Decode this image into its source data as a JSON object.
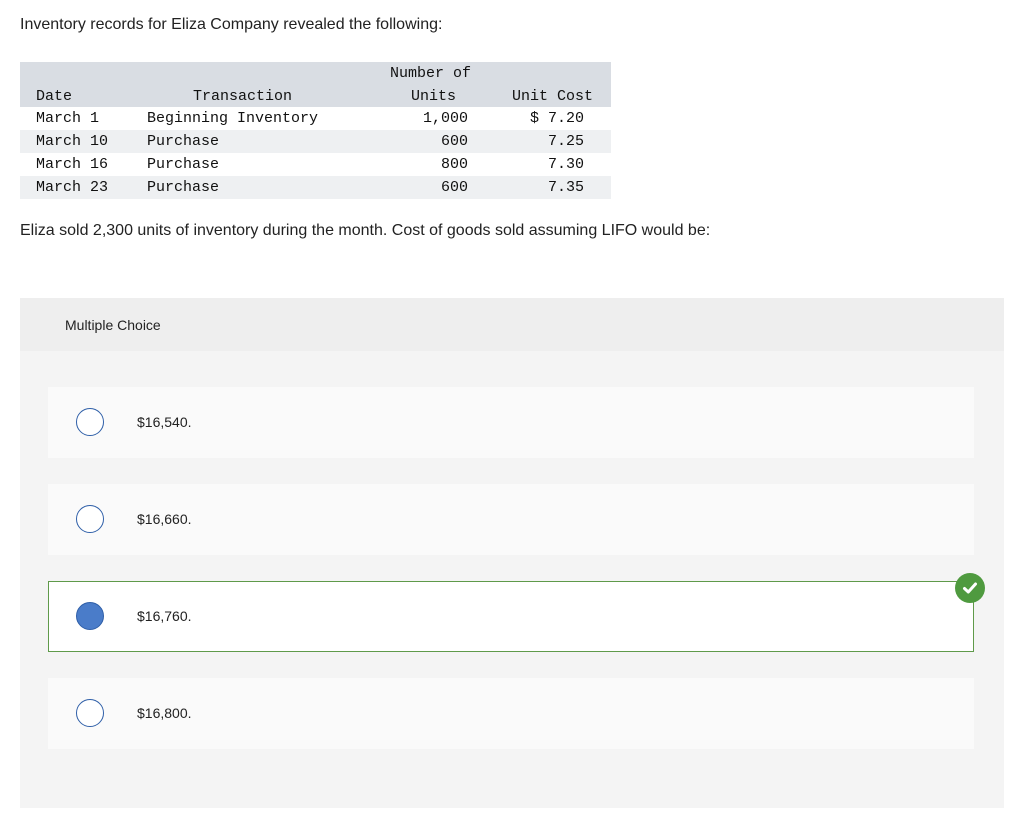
{
  "intro_text": "Inventory records for Eliza Company revealed the following:",
  "table": {
    "headers": {
      "date": "Date",
      "transaction": "Transaction",
      "units_line1": "Number of",
      "units_line2": "Units",
      "cost": "Unit Cost"
    },
    "rows": [
      {
        "date": "March 1",
        "transaction": "Beginning Inventory",
        "units": "1,000",
        "cost": "$ 7.20"
      },
      {
        "date": "March 10",
        "transaction": "Purchase",
        "units": "600",
        "cost": "7.25"
      },
      {
        "date": "March 16",
        "transaction": "Purchase",
        "units": "800",
        "cost": "7.30"
      },
      {
        "date": "March 23",
        "transaction": "Purchase",
        "units": "600",
        "cost": "7.35"
      }
    ]
  },
  "question_text": "Eliza sold 2,300 units of inventory during the month. Cost of goods sold assuming LIFO would be:",
  "multiple_choice": {
    "label": "Multiple Choice",
    "options": [
      {
        "label": "$16,540.",
        "selected": false
      },
      {
        "label": "$16,660.",
        "selected": false
      },
      {
        "label": "$16,760.",
        "selected": true
      },
      {
        "label": "$16,800.",
        "selected": false
      }
    ],
    "correct_icon": "checkmark-icon",
    "correct_color": "#4f9a3f"
  }
}
